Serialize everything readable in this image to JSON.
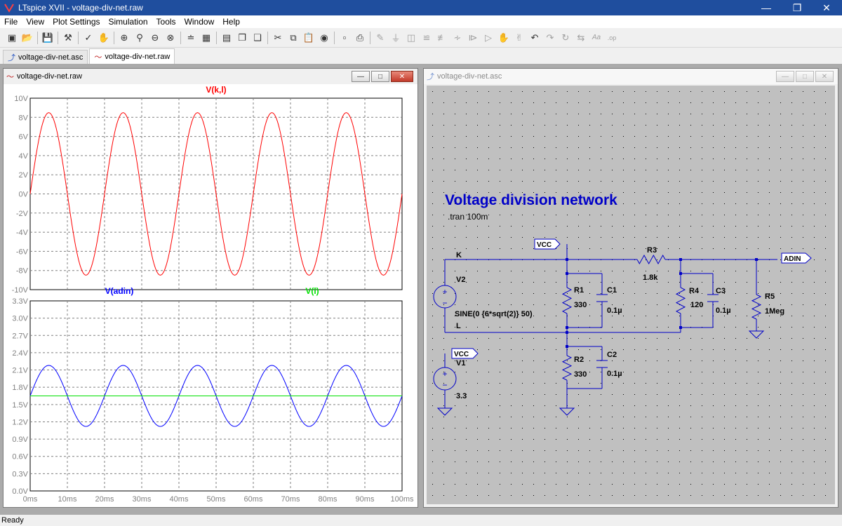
{
  "window": {
    "title": "LTspice XVII - voltage-div-net.raw"
  },
  "menu": [
    "File",
    "View",
    "Plot Settings",
    "Simulation",
    "Tools",
    "Window",
    "Help"
  ],
  "tabs": [
    {
      "label": "voltage-div-net.asc",
      "icon": "schematic-icon",
      "active": false
    },
    {
      "label": "voltage-div-net.raw",
      "icon": "waveform-icon",
      "active": true
    }
  ],
  "waveform_window": {
    "title": "voltage-div-net.raw"
  },
  "schematic_window": {
    "title": "voltage-div-net.asc"
  },
  "status": "Ready",
  "chart_data": [
    {
      "type": "line",
      "title": "",
      "series": [
        {
          "name": "V(k,l)",
          "color": "#ff0000",
          "amplitude": 8.485,
          "offset": 0,
          "frequency_hz": 50
        }
      ],
      "x": {
        "range_ms": [
          0,
          100
        ],
        "ticks": [
          "0ms",
          "10ms",
          "20ms",
          "30ms",
          "40ms",
          "50ms",
          "60ms",
          "70ms",
          "80ms",
          "90ms",
          "100ms"
        ]
      },
      "ylim": [
        -10,
        10
      ],
      "yticks": [
        "10V",
        "8V",
        "6V",
        "4V",
        "2V",
        "0V",
        "-2V",
        "-4V",
        "-6V",
        "-8V",
        "-10V"
      ],
      "grid": true
    },
    {
      "type": "line",
      "title": "",
      "series": [
        {
          "name": "V(adin)",
          "color": "#0000ff",
          "amplitude": 0.53,
          "offset": 1.65,
          "frequency_hz": 50
        },
        {
          "name": "V(l)",
          "color": "#00e000",
          "amplitude": 0,
          "offset": 1.65,
          "frequency_hz": 0
        }
      ],
      "x": {
        "range_ms": [
          0,
          100
        ],
        "ticks": [
          "0ms",
          "10ms",
          "20ms",
          "30ms",
          "40ms",
          "50ms",
          "60ms",
          "70ms",
          "80ms",
          "90ms",
          "100ms"
        ]
      },
      "ylim": [
        0,
        3.3
      ],
      "yticks": [
        "3.3V",
        "3.0V",
        "2.7V",
        "2.4V",
        "2.1V",
        "1.8V",
        "1.5V",
        "1.2V",
        "0.9V",
        "0.6V",
        "0.3V",
        "0.0V"
      ],
      "grid": true
    }
  ],
  "schematic": {
    "title": "Voltage division network",
    "directive": ".tran 100m",
    "nodes": {
      "k": "K",
      "l": "L",
      "vcc1": "VCC",
      "vcc2": "VCC",
      "adin": "ADIN"
    },
    "components": {
      "V2": {
        "name": "V2",
        "value": "SINE(0 {6*sqrt(2)} 50)"
      },
      "V1": {
        "name": "V1",
        "value": "3.3"
      },
      "R1": {
        "name": "R1",
        "value": "330"
      },
      "C1": {
        "name": "C1",
        "value": "0.1µ"
      },
      "R2": {
        "name": "R2",
        "value": "330"
      },
      "C2": {
        "name": "C2",
        "value": "0.1µ"
      },
      "R3": {
        "name": "R3",
        "value": "1.8k"
      },
      "R4": {
        "name": "R4",
        "value": "120"
      },
      "C3": {
        "name": "C3",
        "value": "0.1µ"
      },
      "R5": {
        "name": "R5",
        "value": "1Meg"
      }
    }
  }
}
